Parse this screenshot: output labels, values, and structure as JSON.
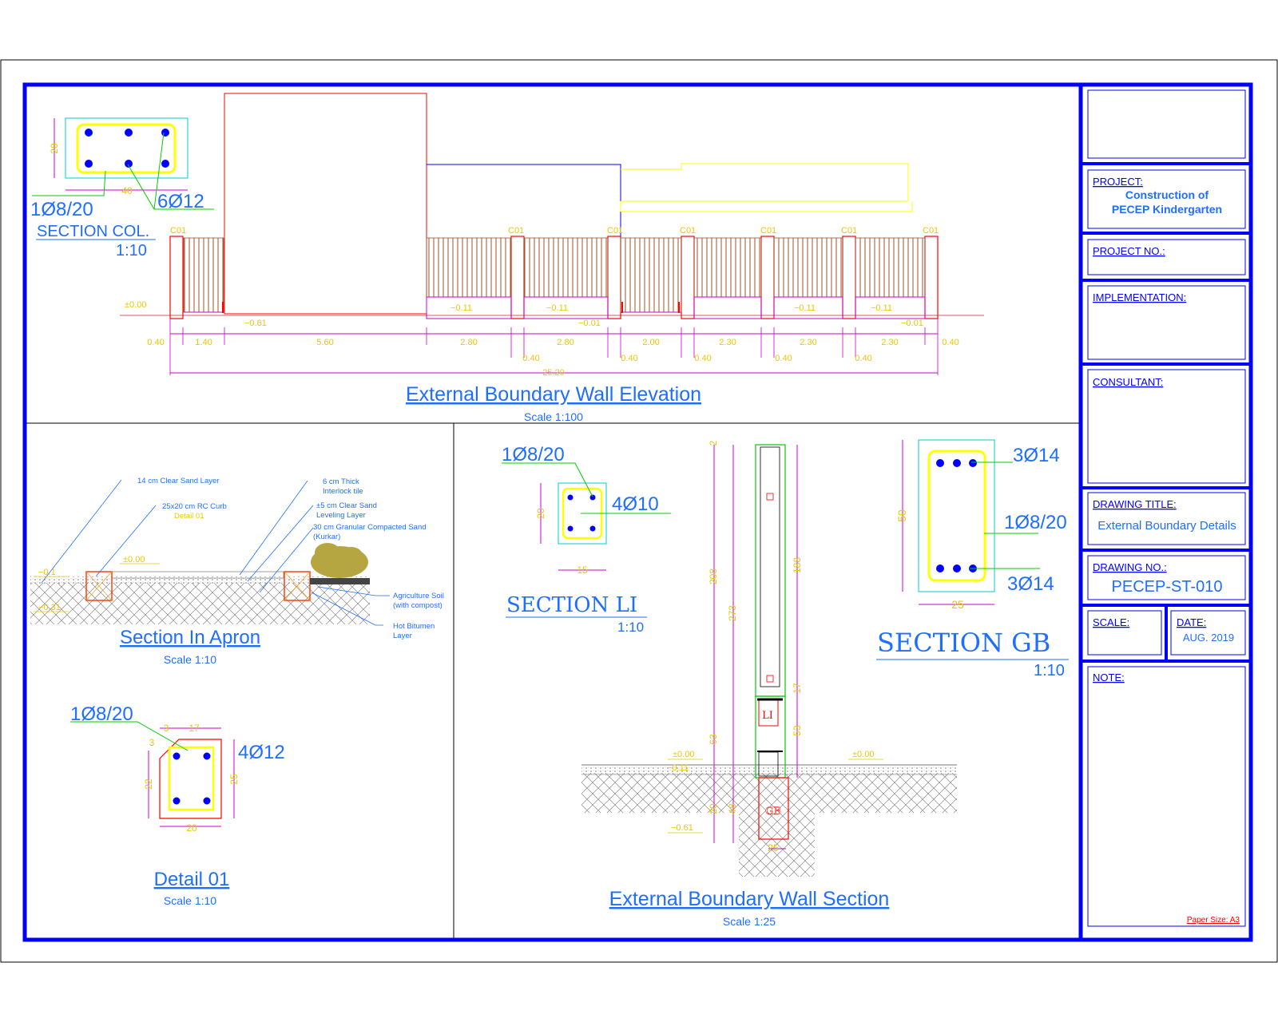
{
  "colors": {
    "frame": "#0000ff",
    "text_blue": "#1e6fff",
    "dim_magenta": "#cc00cc",
    "yellow": "#ffff00",
    "dim_yellow": "#e8c800",
    "red": "#ff0000",
    "green": "#00cc00",
    "cyan": "#00cccc",
    "brown": "#a0522d"
  },
  "title_block": {
    "project_label": "PROJECT:",
    "project_line1": "Construction of",
    "project_line2": "PECEP Kindergarten",
    "project_no_label": "PROJECT NO.:",
    "implementation_label": "IMPLEMENTATION:",
    "consultant_label": "CONSULTANT:",
    "drawing_title_label": "DRAWING TITLE:",
    "drawing_title": "External Boundary Details",
    "drawing_no_label": "DRAWING NO.:",
    "drawing_no": "PECEP-ST-010",
    "scale_label": "SCALE:",
    "date_label": "DATE:",
    "date": "AUG. 2019",
    "note_label": "NOTE:",
    "paper_size": "Paper Size: A3"
  },
  "elevation": {
    "title": "External Boundary Wall Elevation",
    "scale": "Scale 1:100",
    "col_tag": "C01",
    "level_zero": "±0.00",
    "level_m061": "−0.61",
    "level_m011": "−0.11",
    "level_m001": "−0.01",
    "total_dim": "25.20",
    "dims_bottom": [
      "0.40",
      "1.40",
      "5.60",
      "2.80",
      "2.80",
      "2.00",
      "2.30",
      "2.30",
      "2.30",
      "0.40"
    ],
    "dims_col": [
      "0.40",
      "0.40",
      "0.40",
      "0.40",
      "0.40"
    ]
  },
  "section_col": {
    "title": "SECTION COL.",
    "scale": "1:10",
    "stirrup": "1Ø8/20",
    "bars": "6Ø12",
    "width": "40",
    "depth": "20"
  },
  "apron": {
    "title": "Section In Apron",
    "scale": "Scale 1:10",
    "note1": "14 cm Clear Sand Layer",
    "note2": "25x20 cm RC Curb",
    "note2b": "Detail 01",
    "note3": "6 cm Thick",
    "note3b": "Interlock tile",
    "note4": "±5 cm Clear Sand",
    "note4b": "Leveling Layer",
    "note5": "30 cm Granular Compacted Sand",
    "note5b": "(Kurkar)",
    "note6": "Agriculture Soil",
    "note6b": "(with compost)",
    "note7": "Hot Bitumen",
    "note7b": "Layer",
    "level_zero": "±0.00",
    "level_m01": "−0.1",
    "level_m031": "−0.31"
  },
  "detail01": {
    "title": "Detail 01",
    "scale": "Scale 1:10",
    "stirrup": "1Ø8/20",
    "bars": "4Ø12",
    "width": "20",
    "height": "25",
    "inner_height": "22",
    "top_dim": "17",
    "small_dim": "3",
    "side_small": "3"
  },
  "section_li": {
    "title": "SECTION  LI",
    "scale": "1:10",
    "stirrup": "1Ø8/20",
    "bars": "4Ø10",
    "width": "15",
    "depth": "20"
  },
  "wall_section": {
    "title": "External Boundary Wall Section",
    "scale": "Scale 1:25",
    "dim_top": "2",
    "dim_208": "208",
    "dim_273": "273",
    "dim_63": "63",
    "dim_20": "20",
    "dim_48": "48",
    "dim_188": "188",
    "dim_17": "17",
    "dim_53": "53",
    "dim_25": "25",
    "level_zero_l": "±0.00",
    "level_m011": "−0.11",
    "level_zero_r": "±0.00",
    "level_m061": "−0.61",
    "li_tag": "LI",
    "gb_tag": "GB"
  },
  "section_gb": {
    "title": "SECTION   GB",
    "scale": "1:10",
    "top_bars": "3Ø14",
    "stirrup": "1Ø8/20",
    "bottom_bars": "3Ø14",
    "width": "25",
    "depth": "50"
  }
}
